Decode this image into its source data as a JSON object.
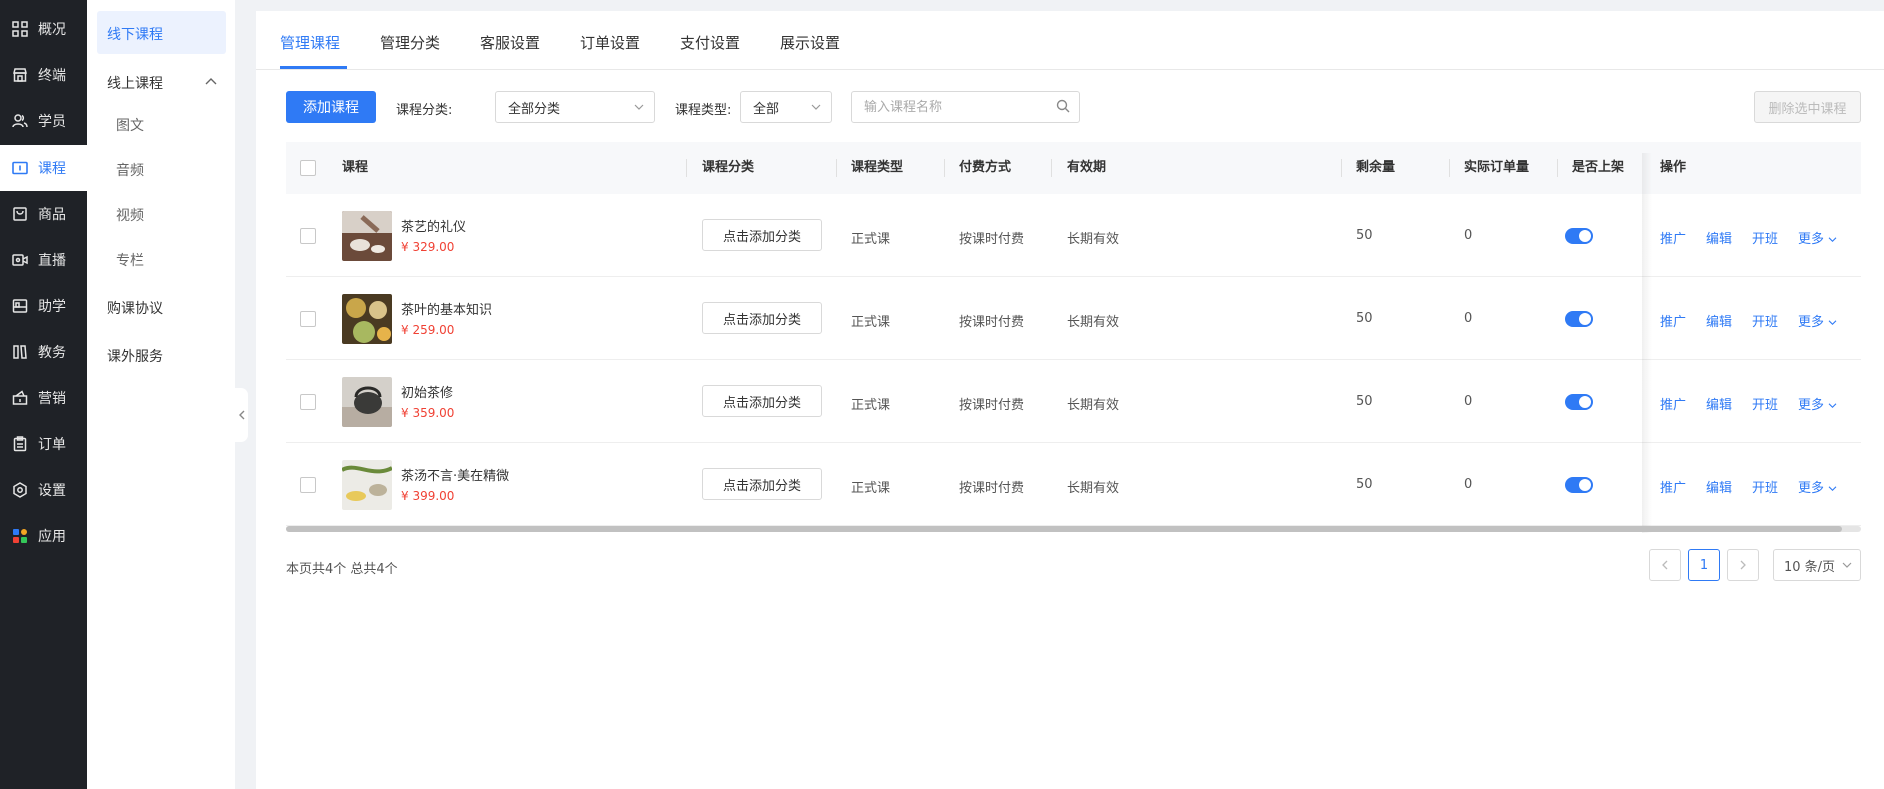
{
  "sidebar": {
    "items": [
      {
        "label": "概况",
        "icon": "grid-icon"
      },
      {
        "label": "终端",
        "icon": "store-icon"
      },
      {
        "label": "学员",
        "icon": "users-icon"
      },
      {
        "label": "课程",
        "icon": "course-icon",
        "active": true
      },
      {
        "label": "商品",
        "icon": "bag-icon"
      },
      {
        "label": "直播",
        "icon": "live-icon"
      },
      {
        "label": "助学",
        "icon": "bed-icon"
      },
      {
        "label": "教务",
        "icon": "book-icon"
      },
      {
        "label": "营销",
        "icon": "gift-icon"
      },
      {
        "label": "订单",
        "icon": "clipboard-icon"
      },
      {
        "label": "设置",
        "icon": "settings-icon"
      },
      {
        "label": "应用",
        "icon": "apps-icon"
      }
    ]
  },
  "subnav": {
    "offline": "线下课程",
    "online": "线上课程",
    "online_children": [
      "图文",
      "音频",
      "视频",
      "专栏"
    ],
    "agreement": "购课协议",
    "extra": "课外服务"
  },
  "tabs": [
    "管理课程",
    "管理分类",
    "客服设置",
    "订单设置",
    "支付设置",
    "展示设置"
  ],
  "toolbar": {
    "add_label": "添加课程",
    "category_label": "课程分类:",
    "category_value": "全部分类",
    "type_label": "课程类型:",
    "type_value": "全部",
    "search_placeholder": "输入课程名称",
    "delete_label": "删除选中课程"
  },
  "table": {
    "headers": {
      "course": "课程",
      "category": "课程分类",
      "type": "课程类型",
      "payment": "付费方式",
      "validity": "有效期",
      "remaining": "剩余量",
      "orders": "实际订单量",
      "listed": "是否上架",
      "actions": "操作"
    },
    "rows": [
      {
        "name": "茶艺的礼仪",
        "price": "¥ 329.00",
        "category_btn": "点击添加分类",
        "type": "正式课",
        "payment": "按课时付费",
        "validity": "长期有效",
        "remaining": "50",
        "orders": "0",
        "listed": true
      },
      {
        "name": "茶叶的基本知识",
        "price": "¥ 259.00",
        "category_btn": "点击添加分类",
        "type": "正式课",
        "payment": "按课时付费",
        "validity": "长期有效",
        "remaining": "50",
        "orders": "0",
        "listed": true
      },
      {
        "name": "初始茶修",
        "price": "¥ 359.00",
        "category_btn": "点击添加分类",
        "type": "正式课",
        "payment": "按课时付费",
        "validity": "长期有效",
        "remaining": "50",
        "orders": "0",
        "listed": true
      },
      {
        "name": "茶汤不言·美在精微",
        "price": "¥ 399.00",
        "category_btn": "点击添加分类",
        "type": "正式课",
        "payment": "按课时付费",
        "validity": "长期有效",
        "remaining": "50",
        "orders": "0",
        "listed": true
      }
    ],
    "actions": {
      "promote": "推广",
      "edit": "编辑",
      "open_class": "开班",
      "more": "更多"
    }
  },
  "pagination": {
    "summary": "本页共4个 总共4个",
    "current": "1",
    "page_size": "10 条/页"
  },
  "colors": {
    "accent": "#2f7af5",
    "price": "#f04134",
    "sidebar_bg": "#1f2227"
  }
}
